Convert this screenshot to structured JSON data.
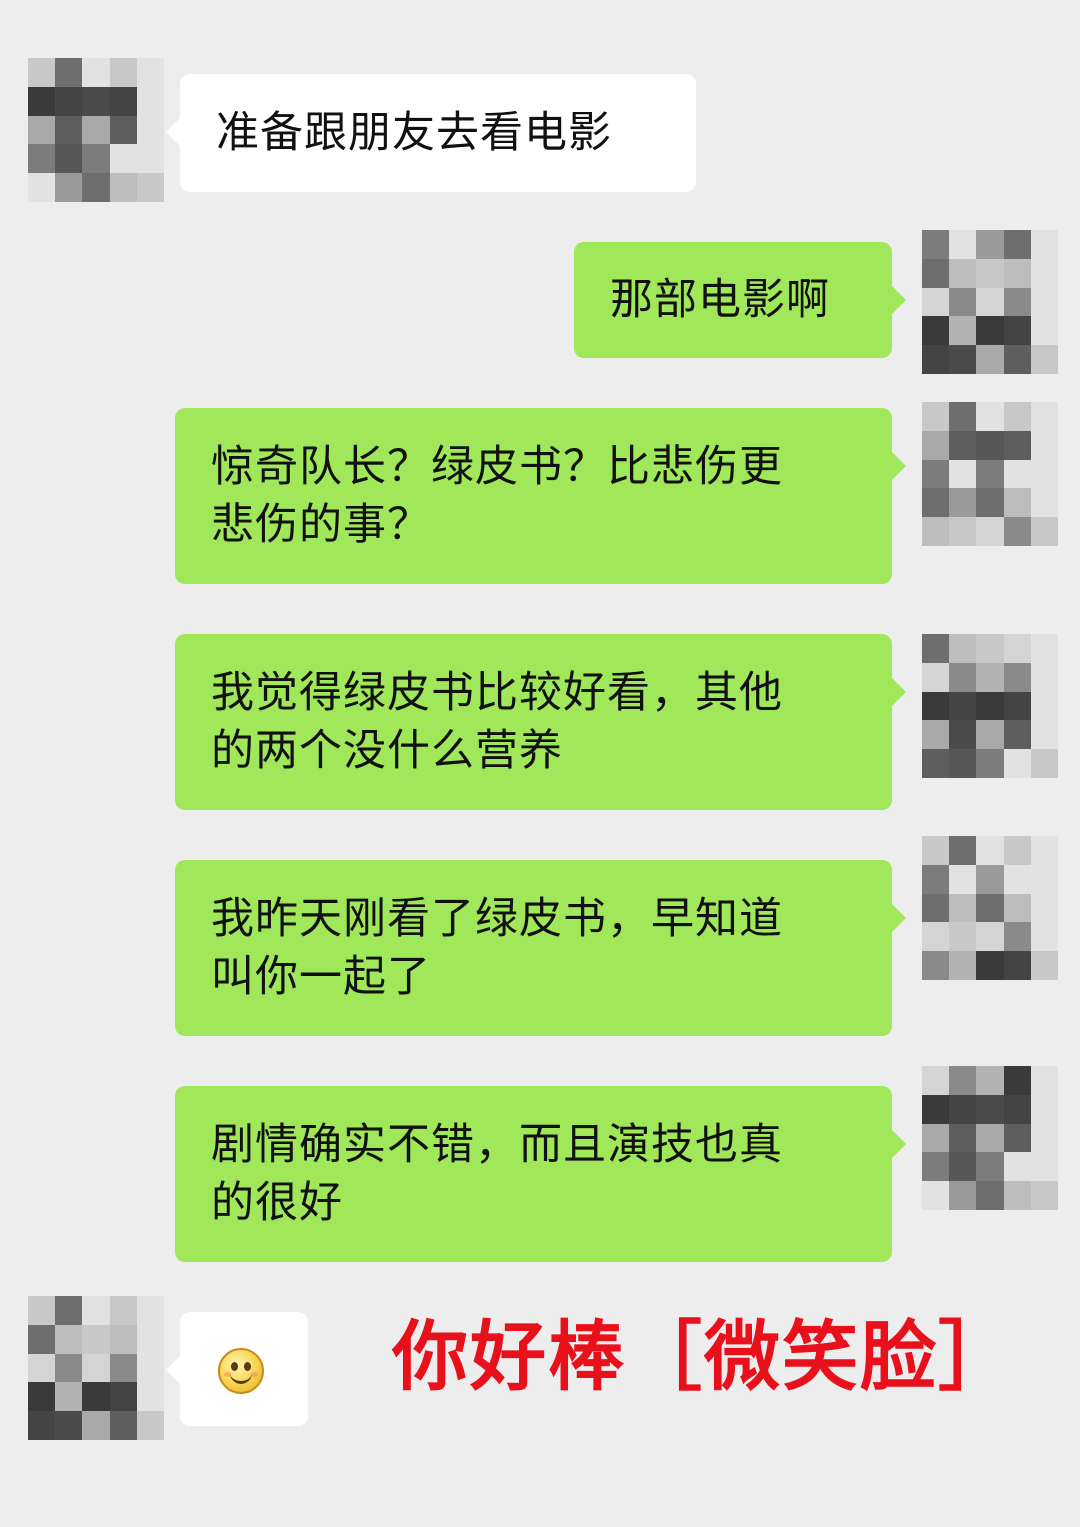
{
  "colors": {
    "background": "#ededed",
    "incoming_bubble": "#ffffff",
    "outgoing_bubble": "#a0e75a",
    "caption": "#e8101a"
  },
  "messages": [
    {
      "side": "incoming",
      "text": "准备跟朋友去看电影"
    },
    {
      "side": "outgoing",
      "text": "那部电影啊"
    },
    {
      "side": "outgoing",
      "lines": [
        "惊奇队长？绿皮书？比悲伤更",
        "悲伤的事？"
      ]
    },
    {
      "side": "outgoing",
      "lines": [
        "我觉得绿皮书比较好看，其他",
        "的两个没什么营养"
      ]
    },
    {
      "side": "outgoing",
      "lines": [
        "我昨天刚看了绿皮书，早知道",
        "叫你一起了"
      ]
    },
    {
      "side": "outgoing",
      "lines": [
        "剧情确实不错，而且演技也真",
        "的很好"
      ]
    },
    {
      "side": "incoming",
      "emoji": "smile-emoji-icon"
    }
  ],
  "caption": "你好棒［微笑脸］"
}
